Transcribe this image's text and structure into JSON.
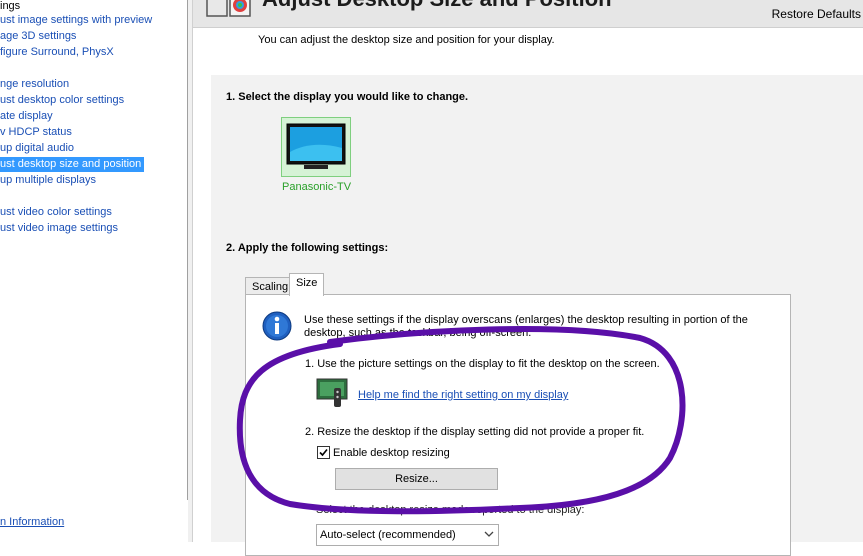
{
  "nav": {
    "items": [
      {
        "label": "ings",
        "kind": "group"
      },
      {
        "label": "ust image settings with preview",
        "kind": "link"
      },
      {
        "label": "age 3D settings",
        "kind": "link"
      },
      {
        "label": "figure Surround, PhysX",
        "kind": "link"
      },
      {
        "label": "nge resolution",
        "kind": "link"
      },
      {
        "label": "ust desktop color settings",
        "kind": "link"
      },
      {
        "label": "ate display",
        "kind": "link"
      },
      {
        "label": "v HDCP status",
        "kind": "link"
      },
      {
        "label": "up digital audio",
        "kind": "link"
      },
      {
        "label": "ust desktop size and position",
        "kind": "selected"
      },
      {
        "label": "up multiple displays",
        "kind": "link"
      },
      {
        "label": "ust video color settings",
        "kind": "link"
      },
      {
        "label": "ust video image settings",
        "kind": "link"
      }
    ],
    "system_info_link": "n Information"
  },
  "header": {
    "title": "Adjust Desktop Size and Position",
    "restore_defaults": "Restore Defaults",
    "subtitle": "You can adjust the desktop size and position for your display."
  },
  "section1": {
    "heading": "1. Select the display you would like to change.",
    "display_name": "Panasonic-TV"
  },
  "section2": {
    "heading": "2. Apply the following settings:",
    "tabs": [
      "Scaling",
      "Size"
    ],
    "active_tab": "Size",
    "info_text": "Use these settings if the display overscans (enlarges) the desktop resulting in portion of the desktop, such as the taskbar, being off-screen.",
    "item1": "1. Use the picture settings on the display to fit the desktop on the screen.",
    "help_link": "Help me find the right setting on my display",
    "item2": "2. Resize the desktop if the display setting did not provide a proper fit.",
    "enable_resizing_label": "Enable desktop resizing",
    "enable_resizing_checked": true,
    "resize_button": "Resize...",
    "mode_label": "Select the desktop resize mode reported to the display:",
    "mode_value": "Auto-select (recommended)"
  },
  "colors": {
    "link": "#1a4fb5",
    "selection": "#3399ff",
    "annotation_stroke": "#5a0fa8",
    "display_label": "#2aa02a"
  }
}
